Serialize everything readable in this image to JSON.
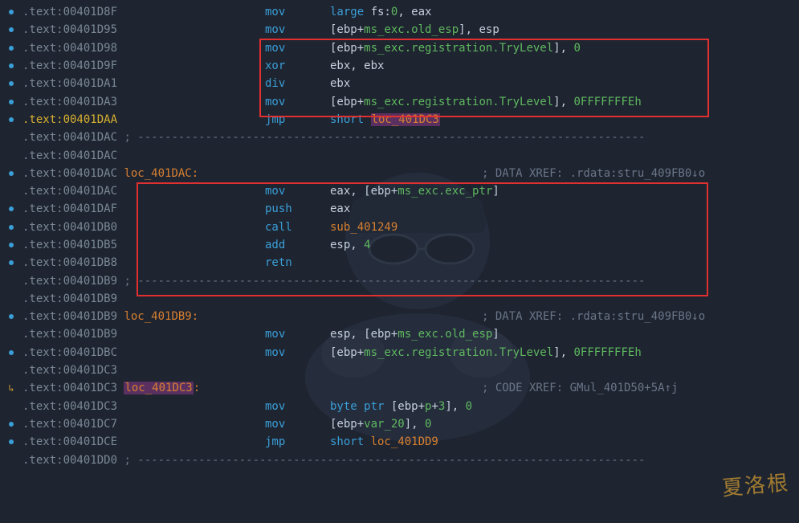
{
  "lines": [
    {
      "marker": "dot",
      "addr": ".text:00401D8F",
      "addr_cls": "addr",
      "mnemonic": "mov",
      "ops": [
        {
          "t": "large ",
          "c": "kw"
        },
        {
          "t": "fs:",
          "c": "reg"
        },
        {
          "t": "0",
          "c": "num"
        },
        {
          "t": ", eax",
          "c": "reg"
        }
      ]
    },
    {
      "marker": "dot",
      "addr": ".text:00401D95",
      "addr_cls": "addr",
      "mnemonic": "mov",
      "ops": [
        {
          "t": "[ebp+",
          "c": "reg"
        },
        {
          "t": "ms_exc.old_esp",
          "c": "struct"
        },
        {
          "t": "], esp",
          "c": "reg"
        }
      ]
    },
    {
      "marker": "dot",
      "addr": ".text:00401D98",
      "addr_cls": "addr",
      "mnemonic": "mov",
      "ops": [
        {
          "t": "[ebp+",
          "c": "reg"
        },
        {
          "t": "ms_exc.registration.TryLevel",
          "c": "struct"
        },
        {
          "t": "], ",
          "c": "reg"
        },
        {
          "t": "0",
          "c": "num"
        }
      ]
    },
    {
      "marker": "dot",
      "addr": ".text:00401D9F",
      "addr_cls": "addr",
      "mnemonic": "xor",
      "ops": [
        {
          "t": "ebx, ebx",
          "c": "reg"
        }
      ]
    },
    {
      "marker": "dot",
      "addr": ".text:00401DA1",
      "addr_cls": "addr",
      "mnemonic": "div",
      "ops": [
        {
          "t": "ebx",
          "c": "reg"
        }
      ]
    },
    {
      "marker": "dot",
      "addr": ".text:00401DA3",
      "addr_cls": "addr",
      "mnemonic": "mov",
      "ops": [
        {
          "t": "[ebp+",
          "c": "reg"
        },
        {
          "t": "ms_exc.registration.TryLevel",
          "c": "struct"
        },
        {
          "t": "], ",
          "c": "reg"
        },
        {
          "t": "0FFFFFFFEh",
          "c": "num"
        }
      ]
    },
    {
      "marker": "dot",
      "addr": ".text:00401DAA",
      "addr_cls": "addr-active",
      "mnemonic": "jmp",
      "ops": [
        {
          "t": "short ",
          "c": "kw"
        },
        {
          "t": "loc_401DC3",
          "c": "label-hl"
        }
      ]
    },
    {
      "marker": "",
      "addr": ".text:00401DAC",
      "addr_cls": "addr",
      "dash": " ; ---------------------------------------------------------------------------"
    },
    {
      "marker": "",
      "addr": ".text:00401DAC",
      "addr_cls": "addr",
      "ops": []
    },
    {
      "marker": "dot",
      "addr": ".text:00401DAC",
      "addr_cls": "addr",
      "label": "loc_401DAC:",
      "xref": "; DATA XREF: .rdata:stru_409FB0↓o"
    },
    {
      "marker": "",
      "addr": ".text:00401DAC",
      "addr_cls": "addr",
      "mnemonic": "mov",
      "ops": [
        {
          "t": "eax, [ebp+",
          "c": "reg"
        },
        {
          "t": "ms_exc.exc_ptr",
          "c": "struct"
        },
        {
          "t": "]",
          "c": "reg"
        }
      ]
    },
    {
      "marker": "dot",
      "addr": ".text:00401DAF",
      "addr_cls": "addr",
      "mnemonic": "push",
      "ops": [
        {
          "t": "eax",
          "c": "reg"
        }
      ]
    },
    {
      "marker": "dot",
      "addr": ".text:00401DB0",
      "addr_cls": "addr",
      "mnemonic": "call",
      "ops": [
        {
          "t": "sub_401249",
          "c": "label"
        }
      ]
    },
    {
      "marker": "dot",
      "addr": ".text:00401DB5",
      "addr_cls": "addr",
      "mnemonic": "add",
      "ops": [
        {
          "t": "esp, ",
          "c": "reg"
        },
        {
          "t": "4",
          "c": "num"
        }
      ]
    },
    {
      "marker": "dot",
      "addr": ".text:00401DB8",
      "addr_cls": "addr",
      "mnemonic": "retn",
      "ops": []
    },
    {
      "marker": "",
      "addr": ".text:00401DB9",
      "addr_cls": "addr",
      "dash": " ; ---------------------------------------------------------------------------"
    },
    {
      "marker": "",
      "addr": ".text:00401DB9",
      "addr_cls": "addr",
      "ops": []
    },
    {
      "marker": "dot",
      "addr": ".text:00401DB9",
      "addr_cls": "addr",
      "label": "loc_401DB9:",
      "xref": "; DATA XREF: .rdata:stru_409FB0↓o"
    },
    {
      "marker": "",
      "addr": ".text:00401DB9",
      "addr_cls": "addr",
      "mnemonic": "mov",
      "ops": [
        {
          "t": "esp, [ebp+",
          "c": "reg"
        },
        {
          "t": "ms_exc.old_esp",
          "c": "struct"
        },
        {
          "t": "]",
          "c": "reg"
        }
      ]
    },
    {
      "marker": "dot",
      "addr": ".text:00401DBC",
      "addr_cls": "addr",
      "mnemonic": "mov",
      "ops": [
        {
          "t": "[ebp+",
          "c": "reg"
        },
        {
          "t": "ms_exc.registration.TryLevel",
          "c": "struct"
        },
        {
          "t": "], ",
          "c": "reg"
        },
        {
          "t": "0FFFFFFFEh",
          "c": "num"
        }
      ]
    },
    {
      "marker": "",
      "addr": ".text:00401DC3",
      "addr_cls": "addr",
      "ops": []
    },
    {
      "marker": "arrow",
      "addr": ".text:00401DC3",
      "addr_cls": "addr",
      "label_hl": "loc_401DC3",
      "label_suffix": ":",
      "xref": "; CODE XREF: GMul_401D50+5A↑j"
    },
    {
      "marker": "",
      "addr": ".text:00401DC3",
      "addr_cls": "addr",
      "mnemonic": "mov",
      "ops": [
        {
          "t": "byte ptr ",
          "c": "kw"
        },
        {
          "t": "[ebp+",
          "c": "reg"
        },
        {
          "t": "p",
          "c": "struct"
        },
        {
          "t": "+",
          "c": "reg"
        },
        {
          "t": "3",
          "c": "num"
        },
        {
          "t": "], ",
          "c": "reg"
        },
        {
          "t": "0",
          "c": "num"
        }
      ]
    },
    {
      "marker": "dot",
      "addr": ".text:00401DC7",
      "addr_cls": "addr",
      "mnemonic": "mov",
      "ops": [
        {
          "t": "[ebp+",
          "c": "reg"
        },
        {
          "t": "var_20",
          "c": "struct"
        },
        {
          "t": "], ",
          "c": "reg"
        },
        {
          "t": "0",
          "c": "num"
        }
      ]
    },
    {
      "marker": "dot",
      "addr": ".text:00401DCE",
      "addr_cls": "addr",
      "mnemonic": "jmp",
      "ops": [
        {
          "t": "short ",
          "c": "kw"
        },
        {
          "t": "loc_401DD9",
          "c": "label"
        }
      ]
    },
    {
      "marker": "",
      "addr": ".text:00401DD0",
      "addr_cls": "addr",
      "dash": " ; ---------------------------------------------------------------------------"
    }
  ],
  "watermark": "夏洛根",
  "opcol": 330,
  "argcol": 411,
  "xrefcol": 600
}
